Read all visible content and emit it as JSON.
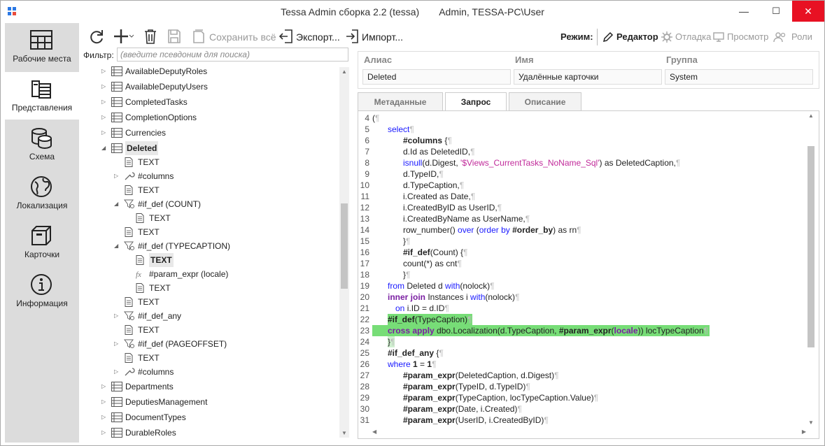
{
  "window": {
    "title": "Tessa Admin сборка 2.2 (tessa)",
    "user": "Admin, TESSA-PC\\User",
    "minimize": "—",
    "maximize": "☐",
    "close": "✕"
  },
  "colors": {
    "accent": "#2b78e4",
    "highlight": "#77dd77",
    "keyword": "#1a1aff",
    "directive": "#7a1fa2",
    "string": "#c12a9a"
  },
  "nav": [
    {
      "label": "Рабочие места",
      "icon": "workplace-icon"
    },
    {
      "label": "Представления",
      "icon": "views-icon"
    },
    {
      "label": "Схема",
      "icon": "database-icon"
    },
    {
      "label": "Локализация",
      "icon": "globe-icon"
    },
    {
      "label": "Карточки",
      "icon": "box-icon"
    },
    {
      "label": "Информация",
      "icon": "info-icon"
    }
  ],
  "toolbar": {
    "save_all": "Сохранить всё",
    "export": "Экспорт...",
    "import": "Импорт...",
    "mode": "Режим:",
    "editor": "Редактор",
    "debug": "Отладка",
    "view": "Просмотр",
    "roles": "Роли"
  },
  "filter": {
    "label": "Фильтр:",
    "placeholder": "(введите псевдоним для поиска)"
  },
  "tree": [
    {
      "t": "AvailableDeputyRoles",
      "lvl": 0,
      "arr": "▷",
      "ic": "view"
    },
    {
      "t": "AvailableDeputyUsers",
      "lvl": 0,
      "arr": "▷",
      "ic": "view"
    },
    {
      "t": "CompletedTasks",
      "lvl": 0,
      "arr": "▷",
      "ic": "view"
    },
    {
      "t": "CompletionOptions",
      "lvl": 0,
      "arr": "▷",
      "ic": "view"
    },
    {
      "t": "Currencies",
      "lvl": 0,
      "arr": "▷",
      "ic": "view"
    },
    {
      "t": "Deleted",
      "lvl": 0,
      "arr": "◢",
      "ic": "view",
      "bold": true,
      "sel": true
    },
    {
      "t": "TEXT",
      "lvl": 1,
      "arr": "",
      "ic": "doc"
    },
    {
      "t": "#columns",
      "lvl": 1,
      "arr": "▷",
      "ic": "wrench"
    },
    {
      "t": "TEXT",
      "lvl": 1,
      "arr": "",
      "ic": "doc"
    },
    {
      "t": "#if_def (COUNT)",
      "lvl": 1,
      "arr": "◢",
      "ic": "filter"
    },
    {
      "t": "TEXT",
      "lvl": 2,
      "arr": "",
      "ic": "doc"
    },
    {
      "t": "TEXT",
      "lvl": 1,
      "arr": "",
      "ic": "doc"
    },
    {
      "t": "#if_def (TYPECAPTION)",
      "lvl": 1,
      "arr": "◢",
      "ic": "filter"
    },
    {
      "t": "TEXT",
      "lvl": 2,
      "arr": "",
      "ic": "doc",
      "bold": true,
      "sel": true
    },
    {
      "t": "#param_expr (locale)",
      "lvl": 2,
      "arr": "",
      "ic": "fx"
    },
    {
      "t": "TEXT",
      "lvl": 2,
      "arr": "",
      "ic": "doc"
    },
    {
      "t": "TEXT",
      "lvl": 1,
      "arr": "",
      "ic": "doc"
    },
    {
      "t": "#if_def_any",
      "lvl": 1,
      "arr": "▷",
      "ic": "filter"
    },
    {
      "t": "TEXT",
      "lvl": 1,
      "arr": "",
      "ic": "doc"
    },
    {
      "t": "#if_def (PAGEOFFSET)",
      "lvl": 1,
      "arr": "▷",
      "ic": "filter"
    },
    {
      "t": "TEXT",
      "lvl": 1,
      "arr": "",
      "ic": "doc"
    },
    {
      "t": "#columns",
      "lvl": 1,
      "arr": "▷",
      "ic": "wrench"
    },
    {
      "t": "Departments",
      "lvl": 0,
      "arr": "▷",
      "ic": "view"
    },
    {
      "t": "DeputiesManagement",
      "lvl": 0,
      "arr": "▷",
      "ic": "view"
    },
    {
      "t": "DocumentTypes",
      "lvl": 0,
      "arr": "▷",
      "ic": "view"
    },
    {
      "t": "DurableRoles",
      "lvl": 0,
      "arr": "▷",
      "ic": "view"
    }
  ],
  "props": {
    "alias_h": "Алиас",
    "name_h": "Имя",
    "group_h": "Группа",
    "alias": "Deleted",
    "name": "Удалённые карточки",
    "group": "System"
  },
  "tabs": [
    "Метаданные",
    "Запрос",
    "Описание"
  ],
  "code": [
    {
      "n": "4",
      "i": 0,
      "s": [
        [
          "(",
          ""
        ]
      ]
    },
    {
      "n": "5",
      "i": 1,
      "s": [
        [
          "select",
          "k"
        ]
      ]
    },
    {
      "n": "6",
      "i": 2,
      "s": [
        [
          "#columns",
          "bd"
        ],
        [
          " {",
          ""
        ]
      ]
    },
    {
      "n": "7",
      "i": 2,
      "s": [
        [
          "d.Id as DeletedID,",
          ""
        ]
      ]
    },
    {
      "n": "8",
      "i": 2,
      "s": [
        [
          "isnull",
          "k"
        ],
        [
          "(d.Digest, ",
          ""
        ],
        [
          "'$Views_CurrentTasks_NoName_Sql'",
          "str"
        ],
        [
          ") as DeletedCaption,",
          ""
        ]
      ]
    },
    {
      "n": "9",
      "i": 2,
      "s": [
        [
          "d.TypeID,",
          ""
        ]
      ]
    },
    {
      "n": "10",
      "i": 2,
      "s": [
        [
          "d.TypeCaption,",
          ""
        ]
      ]
    },
    {
      "n": "11",
      "i": 2,
      "s": [
        [
          "i.Created as Date,",
          ""
        ]
      ]
    },
    {
      "n": "12",
      "i": 2,
      "s": [
        [
          "i.CreatedByID as UserID,",
          ""
        ]
      ]
    },
    {
      "n": "13",
      "i": 2,
      "s": [
        [
          "i.CreatedByName as UserName,",
          ""
        ]
      ]
    },
    {
      "n": "14",
      "i": 2,
      "s": [
        [
          "row_number() ",
          ""
        ],
        [
          "over",
          "k"
        ],
        [
          " (",
          ""
        ],
        [
          "order by",
          "k"
        ],
        [
          " ",
          ""
        ],
        [
          "#order_by",
          "bd"
        ],
        [
          ") as rn",
          ""
        ]
      ]
    },
    {
      "n": "15",
      "i": 2,
      "s": [
        [
          "}",
          ""
        ]
      ]
    },
    {
      "n": "16",
      "i": 2,
      "s": [
        [
          "#if_def",
          "bd"
        ],
        [
          "(Count) {",
          ""
        ]
      ]
    },
    {
      "n": "17",
      "i": 2,
      "s": [
        [
          "count(*) as cnt",
          ""
        ]
      ]
    },
    {
      "n": "18",
      "i": 2,
      "s": [
        [
          "}",
          ""
        ]
      ]
    },
    {
      "n": "19",
      "i": 1,
      "s": [
        [
          "from",
          "k"
        ],
        [
          " Deleted d ",
          ""
        ],
        [
          "with",
          "k"
        ],
        [
          "(nolock)",
          ""
        ]
      ]
    },
    {
      "n": "20",
      "i": 1,
      "s": [
        [
          "inner join",
          "kb"
        ],
        [
          " Instances i ",
          ""
        ],
        [
          "with",
          "k"
        ],
        [
          "(nolock)",
          ""
        ]
      ]
    },
    {
      "n": "21",
      "i": 1.5,
      "s": [
        [
          "on",
          "k"
        ],
        [
          " i.ID = d.ID",
          ""
        ]
      ]
    },
    {
      "n": "22",
      "i": 1,
      "s": [
        [
          "#if_def",
          "bd"
        ],
        [
          "(TypeCaption)",
          ""
        ]
      ],
      "hl": "part"
    },
    {
      "n": "23",
      "i": 1,
      "s": [
        [
          "cross apply",
          "kb"
        ],
        [
          " dbo.Localization(d.TypeCaption, ",
          ""
        ],
        [
          "#param_expr",
          "bd"
        ],
        [
          "(",
          ""
        ],
        [
          "locale",
          "kb"
        ],
        [
          ")) locTypeCaption",
          ""
        ]
      ],
      "hl": "full"
    },
    {
      "n": "24",
      "i": 1,
      "s": [
        [
          "}",
          ""
        ]
      ],
      "hl": "brace"
    },
    {
      "n": "25",
      "i": 1,
      "s": [
        [
          "#if_def_any",
          "bd"
        ],
        [
          " {",
          ""
        ]
      ]
    },
    {
      "n": "26",
      "i": 1,
      "s": [
        [
          "where",
          "k"
        ],
        [
          " ",
          ""
        ],
        [
          "1",
          "bd"
        ],
        [
          " = ",
          ""
        ],
        [
          "1",
          "bd"
        ]
      ]
    },
    {
      "n": "27",
      "i": 2,
      "s": [
        [
          "#param_expr",
          "bd"
        ],
        [
          "(DeletedCaption, d.Digest)",
          ""
        ]
      ]
    },
    {
      "n": "28",
      "i": 2,
      "s": [
        [
          "#param_expr",
          "bd"
        ],
        [
          "(TypeID, d.TypeID)",
          ""
        ]
      ]
    },
    {
      "n": "29",
      "i": 2,
      "s": [
        [
          "#param_expr",
          "bd"
        ],
        [
          "(TypeCaption, locTypeCaption.Value)",
          ""
        ]
      ]
    },
    {
      "n": "30",
      "i": 2,
      "s": [
        [
          "#param_expr",
          "bd"
        ],
        [
          "(Date, i.Created)",
          ""
        ]
      ]
    },
    {
      "n": "31",
      "i": 2,
      "s": [
        [
          "#param_expr",
          "bd"
        ],
        [
          "(UserID, i.CreatedByID)",
          ""
        ]
      ]
    }
  ]
}
